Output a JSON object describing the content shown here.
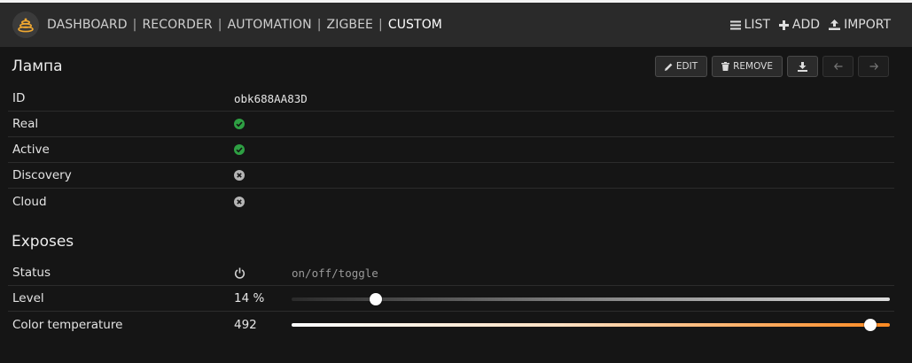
{
  "nav": {
    "items": [
      {
        "label": "DASHBOARD",
        "active": false
      },
      {
        "label": "RECORDER",
        "active": false
      },
      {
        "label": "AUTOMATION",
        "active": false
      },
      {
        "label": "ZIGBEE",
        "active": false
      },
      {
        "label": "CUSTOM",
        "active": true
      }
    ],
    "separator": "|",
    "right": {
      "list": "LIST",
      "add": "ADD",
      "import": "IMPORT"
    }
  },
  "device": {
    "title": "Лампа",
    "toolbar": {
      "edit": "EDIT",
      "remove": "REMOVE"
    },
    "props": [
      {
        "label": "ID",
        "value": "obk688AA83D"
      },
      {
        "label": "Real",
        "icon": "check-circle-icon",
        "status": true
      },
      {
        "label": "Active",
        "icon": "check-circle-icon",
        "status": true
      },
      {
        "label": "Discovery",
        "icon": "x-circle-icon",
        "status": false
      },
      {
        "label": "Cloud",
        "icon": "x-circle-icon",
        "status": false
      }
    ]
  },
  "exposes": {
    "title": "Exposes",
    "status": {
      "label": "Status",
      "icon": "power-icon",
      "placeholder": "on/off/toggle"
    },
    "level": {
      "label": "Level",
      "value": "14 %",
      "fraction": 0.14
    },
    "color_temperature": {
      "label": "Color temperature",
      "value": "492",
      "fraction": 0.968
    }
  },
  "colors": {
    "ok": "#2ea043",
    "off": "#b5b5b5",
    "accent": "#ff8a22"
  }
}
